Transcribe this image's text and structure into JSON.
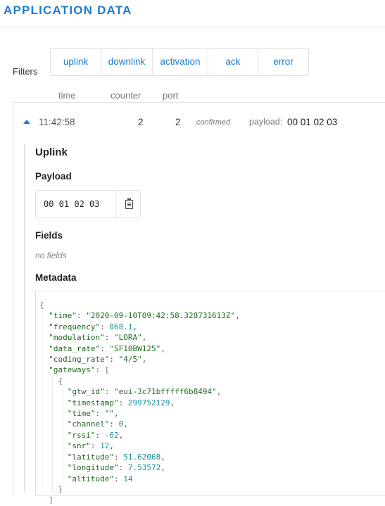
{
  "header": {
    "title": "APPLICATION DATA"
  },
  "filters": {
    "label": "Filters",
    "buttons": [
      "uplink",
      "downlink",
      "activation",
      "ack",
      "error"
    ]
  },
  "columns": {
    "time": "time",
    "counter": "counter",
    "port": "port"
  },
  "message": {
    "time": "11:42:58",
    "counter": "2",
    "port": "2",
    "confirmed": "confirmed",
    "payload_label": "payload:",
    "payload": "00 01 02 03"
  },
  "detail": {
    "title": "Uplink",
    "payload_heading": "Payload",
    "payload_hex": "00 01 02 03",
    "copy_icon": "clipboard-icon",
    "fields_heading": "Fields",
    "no_fields": "no fields",
    "metadata_heading": "Metadata"
  },
  "metadata": {
    "time": "2020-09-10T09:42:58.328731613Z",
    "frequency": "868.1",
    "modulation": "LORA",
    "data_rate": "SF10BW125",
    "coding_rate": "4/5",
    "gateway": {
      "gtw_id": "eui-3c71bfffff6b8494",
      "timestamp": "299752129",
      "time": "",
      "channel": "0",
      "rssi": "-62",
      "snr": "12",
      "latitude": "51.62068",
      "longitude": "7.53572",
      "altitude": "14"
    }
  },
  "colors": {
    "accent": "#1f7ccf",
    "json_key": "#1d6b1d",
    "json_number": "#1a8f9a"
  }
}
